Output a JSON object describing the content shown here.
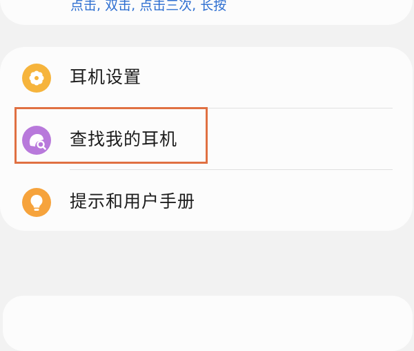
{
  "colors": {
    "page_background": "#f2f2f2",
    "card_background": "#fcfcfc",
    "subtitle_blue": "#2e6fd1",
    "settings_icon": "#f6b43c",
    "find_icon": "#b879db",
    "tips_icon": "#f6a33c",
    "highlight": "#e07042"
  },
  "top_card": {
    "subtitle": "点击, 双击, 点击三次, 长按"
  },
  "menu": {
    "items": [
      {
        "label": "耳机设置",
        "icon": "gear-icon"
      },
      {
        "label": "查找我的耳机",
        "icon": "find-earbuds-icon",
        "highlighted": true
      },
      {
        "label": "提示和用户手册",
        "icon": "lightbulb-icon"
      }
    ]
  }
}
